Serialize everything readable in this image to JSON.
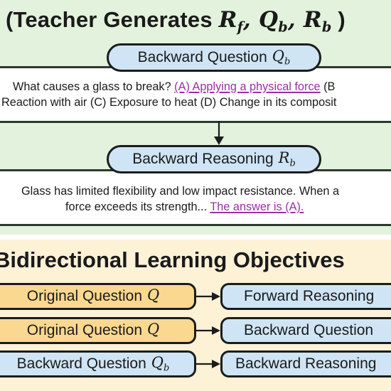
{
  "header": {
    "title_prefix": "(Teacher Generates",
    "title_suffix": ")",
    "title_math": {
      "r": "R",
      "r_sub": "f",
      "q": "Q",
      "q_sub": "b",
      "rb": "R",
      "rb_sub": "b"
    }
  },
  "backward_question": {
    "label": "Backward Question",
    "symbol": "Q",
    "symbol_sub": "b",
    "text_line1_before": "What causes a glass to break?",
    "text_line1_highlight": "(A) Applying a physical force",
    "text_line1_after": "(B",
    "text_line2": "Reaction with air (C) Exposure to heat (D) Change in its composit"
  },
  "backward_reasoning": {
    "label": "Backward Reasoning",
    "symbol": "R",
    "symbol_sub": "b",
    "text_line1": "Glass has limited flexibility and low impact resistance. When a",
    "text_line2_before": "force exceeds its strength...",
    "text_line2_highlight": "The answer is (A)."
  },
  "objectives": {
    "title": "Bidirectional Learning Objectives",
    "rows": [
      {
        "left_label": "Original Question",
        "left_symbol": "Q",
        "left_sub": "",
        "right_label": "Forward Reasoning"
      },
      {
        "left_label": "Original Question",
        "left_symbol": "Q",
        "left_sub": "",
        "right_label": "Backward Question"
      },
      {
        "left_label": "Backward Question",
        "left_symbol": "Q",
        "left_sub": "b",
        "right_label": "Backward Reasoning"
      }
    ]
  },
  "colors": {
    "green_bg": "#e3f2dc",
    "yellow_bg": "#fdf1d6",
    "pill_blue": "#cfe5f5",
    "box_orange": "#fbd890",
    "highlight": "#9a2fa4"
  }
}
